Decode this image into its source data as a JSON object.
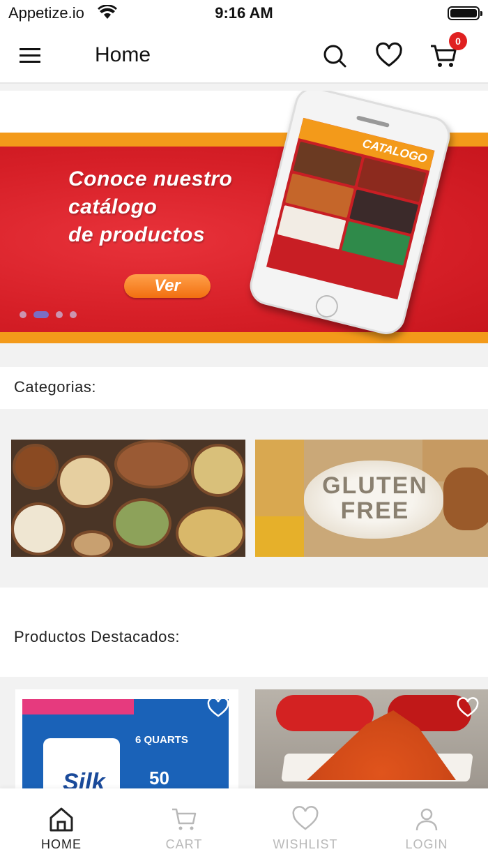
{
  "status_bar": {
    "carrier": "Appetize.io",
    "time": "9:16 AM"
  },
  "app_bar": {
    "title": "Home",
    "cart_count": "0"
  },
  "banner": {
    "headline_lines": [
      "Conoce nuestro",
      "catálogo",
      "de productos"
    ],
    "cta_label": "Ver",
    "phone_header": "CATALOGO",
    "active_slide": 2,
    "slide_count": 4
  },
  "categories": {
    "title": "Categorias:",
    "items": [
      {
        "name": "nuts"
      },
      {
        "name": "gluten-free",
        "image_text": "GLUTEN FREE"
      }
    ]
  },
  "featured": {
    "title": "Productos Destacados:",
    "products": [
      {
        "image_text": [
          "6 QUARTS",
          "50",
          "Silk"
        ]
      },
      {
        "image_text": []
      }
    ]
  },
  "bottom_nav": {
    "items": [
      {
        "label": "HOME",
        "active": true
      },
      {
        "label": "CART",
        "active": false
      },
      {
        "label": "WISHLIST",
        "active": false
      },
      {
        "label": "LOGIN",
        "active": false
      }
    ]
  },
  "colors": {
    "brand_red": "#d61f27",
    "brand_orange": "#f39a1a",
    "badge_red": "#e02020",
    "inactive_nav": "#b8b8b8"
  }
}
